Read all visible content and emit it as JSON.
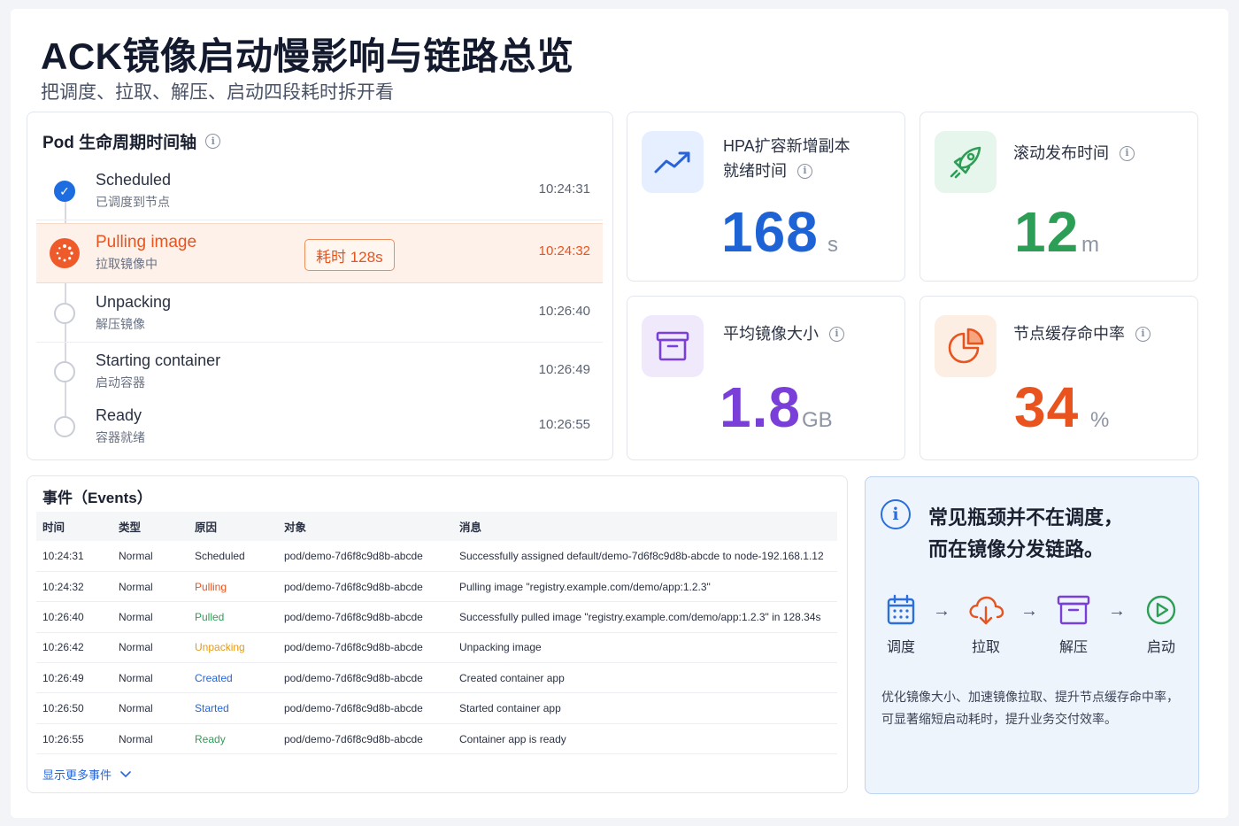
{
  "header": {
    "title": "ACK镜像启动慢影响与链路总览",
    "subtitle": "把调度、拉取、解压、启动四段耗时拆开看"
  },
  "timeline": {
    "title": "Pod 生命周期时间轴",
    "steps": [
      {
        "name": "Scheduled",
        "desc": "已调度到节点",
        "time": "10:24:31",
        "state": "done"
      },
      {
        "name": "Pulling image",
        "desc": "拉取镜像中",
        "time": "10:24:32",
        "state": "active",
        "badge": "耗时 128s"
      },
      {
        "name": "Unpacking",
        "desc": "解压镜像",
        "time": "10:26:40",
        "state": "pending"
      },
      {
        "name": "Starting container",
        "desc": "启动容器",
        "time": "10:26:49",
        "state": "pending"
      },
      {
        "name": "Ready",
        "desc": "容器就绪",
        "time": "10:26:55",
        "state": "pending"
      }
    ]
  },
  "metrics": [
    {
      "label_line1": "HPA扩容新增副本",
      "label_line2": "就绪时间",
      "value": "168",
      "unit": "s",
      "color": "#1d63d6",
      "icon": "trend-up-icon"
    },
    {
      "label_line1": "滚动发布时间",
      "value": "12",
      "unit": "m",
      "color": "#2c9e55",
      "icon": "rocket-icon"
    },
    {
      "label_line1": "平均镜像大小",
      "value": "1.8",
      "unit": "GB",
      "color": "#7a3fd8",
      "icon": "archive-box-icon"
    },
    {
      "label_line1": "节点缓存命中率",
      "value": "34",
      "unit": "%",
      "color": "#e8531e",
      "icon": "pie-chart-icon"
    }
  ],
  "events": {
    "title": "事件（Events）",
    "columns": [
      "时间",
      "类型",
      "原因",
      "对象",
      "消息"
    ],
    "rows": [
      {
        "time": "10:24:31",
        "type": "Normal",
        "reason": "Scheduled",
        "reason_color": "#2a3142",
        "object": "pod/demo-7d6f8c9d8b-abcde",
        "message": "Successfully assigned default/demo-7d6f8c9d8b-abcde to node-192.168.1.12"
      },
      {
        "time": "10:24:32",
        "type": "Normal",
        "reason": "Pulling",
        "reason_color": "#e8531e",
        "object": "pod/demo-7d6f8c9d8b-abcde",
        "message": "Pulling image \"registry.example.com/demo/app:1.2.3\""
      },
      {
        "time": "10:26:40",
        "type": "Normal",
        "reason": "Pulled",
        "reason_color": "#2f9e55",
        "object": "pod/demo-7d6f8c9d8b-abcde",
        "message": "Successfully pulled image \"registry.example.com/demo/app:1.2.3\" in 128.34s"
      },
      {
        "time": "10:26:42",
        "type": "Normal",
        "reason": "Unpacking",
        "reason_color": "#e89a12",
        "object": "pod/demo-7d6f8c9d8b-abcde",
        "message": "Unpacking image"
      },
      {
        "time": "10:26:49",
        "type": "Normal",
        "reason": "Created",
        "reason_color": "#2766d6",
        "object": "pod/demo-7d6f8c9d8b-abcde",
        "message": "Created container app"
      },
      {
        "time": "10:26:50",
        "type": "Normal",
        "reason": "Started",
        "reason_color": "#2766d6",
        "object": "pod/demo-7d6f8c9d8b-abcde",
        "message": "Started container app"
      },
      {
        "time": "10:26:55",
        "type": "Normal",
        "reason": "Ready",
        "reason_color": "#2f9e55",
        "object": "pod/demo-7d6f8c9d8b-abcde",
        "message": "Container app is ready"
      }
    ],
    "more_label": "显示更多事件"
  },
  "insight": {
    "title_line1": "常见瓶颈并不在调度，",
    "title_line2": "而在镜像分发链路。",
    "flow": [
      {
        "label": "调度",
        "icon": "calendar-icon"
      },
      {
        "label": "拉取",
        "icon": "cloud-download-icon"
      },
      {
        "label": "解压",
        "icon": "archive-box-icon"
      },
      {
        "label": "启动",
        "icon": "play-circle-icon"
      }
    ],
    "arrow": "→",
    "text": "优化镜像大小、加速镜像拉取、提升节点缓存命中率，可显著缩短启动耗时，提升业务交付效率。"
  }
}
